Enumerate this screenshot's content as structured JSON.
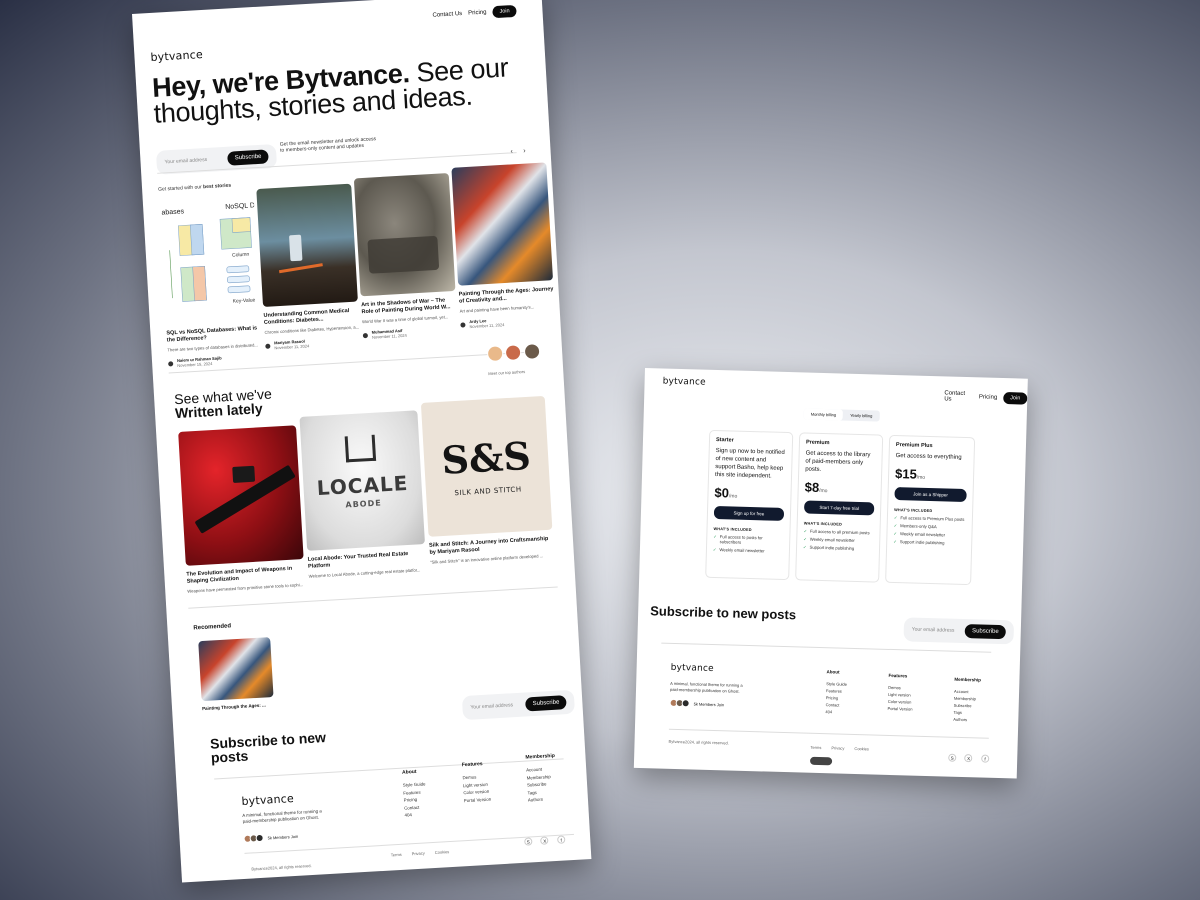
{
  "brand": "bytvance",
  "nav": {
    "contact": "Contact Us",
    "pricing": "Pricing",
    "join": "Join"
  },
  "hero": {
    "title_bold": "Hey, we're Bytvance.",
    "title_rest": " See our thoughts, stories and ideas.",
    "email_placeholder": "Your email address",
    "subscribe": "Subscribe",
    "tagline": "Get the email newsletter and unlock access to members-only content and updates"
  },
  "best": {
    "label_prefix": "Get started with our ",
    "label_bold": "best stories",
    "prev": "‹",
    "next": "›",
    "cards": [
      {
        "title": "SQL vs NoSQL Databases: What is the Difference?",
        "excerpt": "There are two types of databases in distributed...",
        "author": "Naiem ur Rahman Sajib",
        "date": "November 15, 2024",
        "img_label_a": "abases",
        "img_label_b": "NoSQL D",
        "img_label_c": "Column",
        "img_label_d": "Key-Value"
      },
      {
        "title": "Understanding Common Medical Conditions: Diabetes...",
        "excerpt": "Chronic conditions like Diabetes, Hypertension, a...",
        "author": "Mariyam Rasool",
        "date": "November 11, 2024"
      },
      {
        "title": "Art in the Shadows of War – The Role of Painting During World W...",
        "excerpt": "World War II was a time of global turmoil, yet...",
        "author": "Muhammad Asif",
        "date": "November 11, 2024"
      },
      {
        "title": "Painting Through the Ages: Journey of Creativity and...",
        "excerpt": "Art and painting have been humanity's...",
        "author": "Ardy Lee",
        "date": "November 11, 2024"
      }
    ]
  },
  "authors_link": "Meet our top authors",
  "written": {
    "title_top": "See what we've",
    "title_bold": "Written lately",
    "cards": [
      {
        "title": "The Evolution and Impact of Weapons in Shaping Civilization",
        "excerpt": "Weapons have permeated from primitive stone tools to sophi..."
      },
      {
        "title": "Local Abode: Your Trusted Real Estate Platform",
        "excerpt": "Welcome to Local Abode, a cutting-edge real estate platfor...",
        "logo_main": "LOCALE",
        "logo_sub": "ABODE"
      },
      {
        "title": "Silk and Stitch: A Journey into Craftsmanship by Mariyam Rasool",
        "excerpt": "\"Silk and Stitch\" is an innovative online platform developed ...",
        "logo_main": "S&S",
        "logo_sub": "SILK AND STITCH"
      }
    ]
  },
  "recommended": {
    "label": "Recomended",
    "card_title": "Painting Through the Ages: ..."
  },
  "subscribe": {
    "title": "Subscribe to new posts",
    "placeholder": "Your email address",
    "button": "Subscribe"
  },
  "footer": {
    "blurb": "A minimal, functional theme for running a paid-membership publication on Ghost.",
    "members": "5k Members Join",
    "columns": [
      {
        "head": "About",
        "links": [
          "Style Guide",
          "Features",
          "Pricing",
          "Contact",
          "404"
        ]
      },
      {
        "head": "Features",
        "links": [
          "Demos",
          "Light version",
          "Color version",
          "Portal Version"
        ]
      },
      {
        "head": "Membership",
        "links": [
          "Account",
          "Membership",
          "Subscribe",
          "Tags",
          "Authors"
        ]
      }
    ],
    "copyright": "Bytvance2024, all rights reserved.",
    "bottom_links": [
      "Terms",
      "Privacy",
      "Cookies"
    ],
    "socials": [
      "S",
      "X",
      "f"
    ]
  },
  "pricing": {
    "monthly": "Monthly billing",
    "yearly": "Yearly billing",
    "plans": [
      {
        "name": "Starter",
        "desc": "Sign up now to be notified of new content and support Basho, help keep this site independent.",
        "price": "$0",
        "per": "/mo",
        "cta": "Sign up for free",
        "features": [
          "Full access to posts for subscribers",
          "Weekly email newsletter"
        ]
      },
      {
        "name": "Premium",
        "desc": "Get access to the library of paid-members only posts.",
        "price": "$8",
        "per": "/mo",
        "cta": "Start 7-day free trial",
        "features": [
          "Full access to all premium posts",
          "Weekly email newsletter",
          "Support indie publishing"
        ]
      },
      {
        "name": "Premium Plus",
        "desc": "Get access to everything",
        "price": "$15",
        "per": "/mo",
        "cta": "Join as a Shipper",
        "features": [
          "Full access to Premium Plus posts",
          "Members-only Q&A",
          "Weekly email newsletter",
          "Support indie publishing"
        ]
      }
    ],
    "included_label": "WHAT'S INCLUDED"
  },
  "colors": {
    "dark": "#0b0b0b",
    "navy": "#111a2e",
    "check": "#2b9d5c"
  }
}
